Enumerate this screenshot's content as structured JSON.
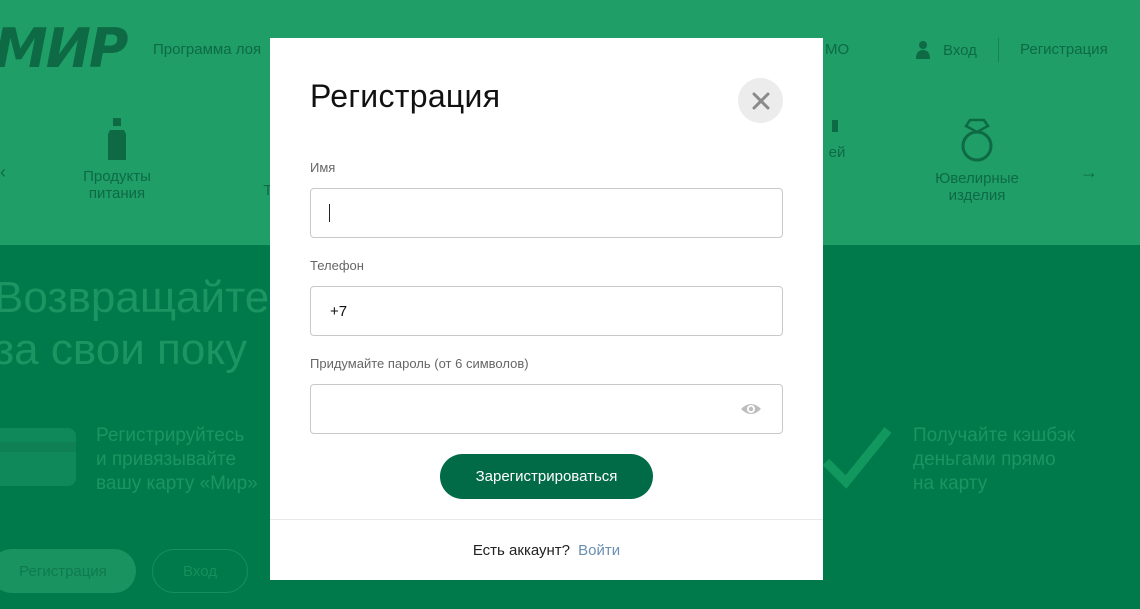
{
  "background": {
    "logo": "МИР",
    "nav": {
      "program_link": "Программа лоя",
      "promo_link": "МО",
      "login_label": "Вход",
      "register_label": "Регистрация"
    },
    "categories": [
      {
        "label_line1": "Продукты",
        "label_line2": "питания",
        "icon": "bottle-icon"
      },
      {
        "label_line1": "Т",
        "label_line2": "",
        "icon": ""
      },
      {
        "label_line1": "ей",
        "label_line2": "",
        "icon": "bag-icon"
      },
      {
        "label_line1": "Ювелирные",
        "label_line2": "изделия",
        "icon": "ring-icon"
      }
    ],
    "headline_line1": "Возвращайте",
    "headline_line2": "за свои поку",
    "feature_left": [
      "Регистрируйтесь",
      "и привязывайте",
      "вашу карту «Мир»"
    ],
    "feature_right": [
      "Получайте кэшбэк",
      "деньгами прямо",
      "на карту"
    ],
    "buttons": {
      "register": "Регистрация",
      "login": "Вход"
    },
    "colors": {
      "top": "#1f9e68",
      "bottom": "#007a4a"
    }
  },
  "modal": {
    "title": "Регистрация",
    "fields": {
      "name": {
        "label": "Имя",
        "value": ""
      },
      "phone": {
        "label": "Телефон",
        "value": "+7"
      },
      "password": {
        "label": "Придумайте пароль (от 6 символов)",
        "value": ""
      }
    },
    "submit_label": "Зарегистрироваться",
    "footer": {
      "question": "Есть аккаунт?",
      "login_link": "Войти"
    },
    "colors": {
      "accent": "#006b46",
      "link": "#6a8fb0"
    }
  }
}
